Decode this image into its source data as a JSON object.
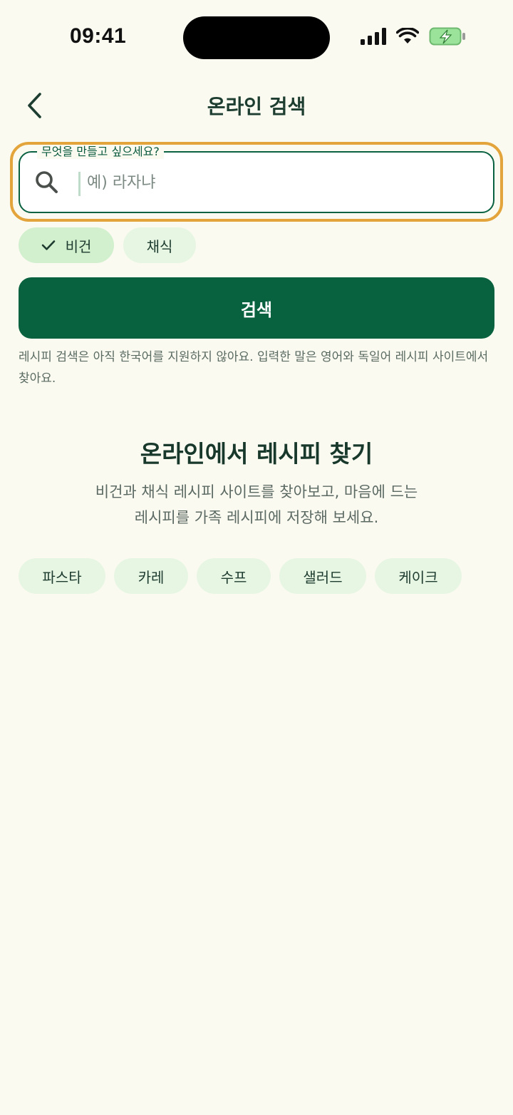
{
  "status_bar": {
    "time": "09:41"
  },
  "header": {
    "title": "온라인 검색"
  },
  "search": {
    "label": "무엇을 만들고 싶으세요?",
    "placeholder": "예) 라자냐",
    "value": ""
  },
  "filters": [
    {
      "label": "비건",
      "selected": true
    },
    {
      "label": "채식",
      "selected": false
    }
  ],
  "search_button": {
    "label": "검색"
  },
  "notice": "레시피 검색은 아직 한국어를 지원하지 않아요. 입력한 말은 영어와 독일어 레시피 사이트에서 찾아요.",
  "empty_state": {
    "title": "온라인에서 레시피 찾기",
    "subtitle_line1": "비건과 채식 레시피 사이트를 찾아보고, 마음에 드는",
    "subtitle_line2": "레시피를 가족 레시피에 저장해 보세요."
  },
  "suggestions": [
    "파스타",
    "카레",
    "수프",
    "샐러드",
    "케이크"
  ],
  "colors": {
    "background": "#FBFAF1",
    "primary": "#08613F",
    "chip": "#E7F6E3",
    "chip_selected": "#D2EFCE",
    "focus_ring": "#E3A53B"
  }
}
